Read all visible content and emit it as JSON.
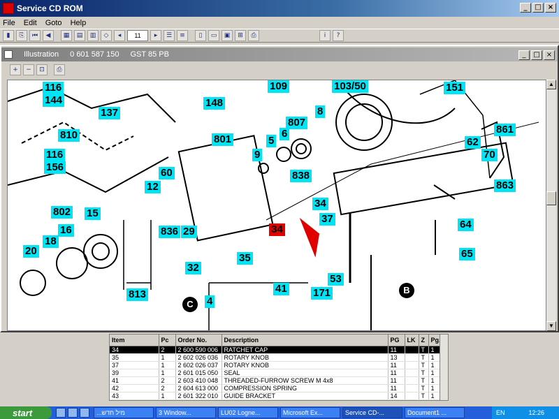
{
  "window": {
    "title": "Service CD ROM",
    "buttons": [
      "_",
      "□",
      "×"
    ]
  },
  "menu": {
    "items": [
      "File",
      "Edit",
      "Goto",
      "Help"
    ]
  },
  "toolbar": {
    "page_value": "11",
    "icons": [
      "exit-icon",
      "copy-icon",
      "first-page-icon",
      "prev-icon",
      "overview-icon",
      "grid-icon",
      "parts-icon",
      "blank-icon",
      "prev-page-icon",
      "next-page-icon",
      "list-icon",
      "list2-icon",
      "new-doc-icon",
      "open-icon",
      "save-icon",
      "bookmark-icon",
      "print-icon",
      "info-icon",
      "help-icon"
    ]
  },
  "illustration": {
    "title": "Illustration",
    "part_no": "0 601 587 150",
    "model": "GST 85 PB",
    "tools": [
      "zoom-in-icon",
      "zoom-out-icon",
      "fit-icon",
      "print-icon"
    ]
  },
  "callouts": [
    {
      "label": "109"
    },
    {
      "label": "103/50"
    },
    {
      "label": "151"
    },
    {
      "label": "116"
    },
    {
      "label": "144"
    },
    {
      "label": "148"
    },
    {
      "label": "137"
    },
    {
      "label": "8"
    },
    {
      "label": "807"
    },
    {
      "label": "6"
    },
    {
      "label": "5"
    },
    {
      "label": "801"
    },
    {
      "label": "810"
    },
    {
      "label": "861"
    },
    {
      "label": "62"
    },
    {
      "label": "116"
    },
    {
      "label": "9"
    },
    {
      "label": "70"
    },
    {
      "label": "156"
    },
    {
      "label": "838"
    },
    {
      "label": "60"
    },
    {
      "label": "863"
    },
    {
      "label": "12"
    },
    {
      "label": "34"
    },
    {
      "label": "802"
    },
    {
      "label": "15"
    },
    {
      "label": "37"
    },
    {
      "label": "16"
    },
    {
      "label": "836"
    },
    {
      "label": "29"
    },
    {
      "label": "34"
    },
    {
      "label": "64"
    },
    {
      "label": "18"
    },
    {
      "label": "20"
    },
    {
      "label": "35"
    },
    {
      "label": "65"
    },
    {
      "label": "32"
    },
    {
      "label": "53"
    },
    {
      "label": "41"
    },
    {
      "label": "171"
    },
    {
      "label": "813"
    },
    {
      "label": "4"
    }
  ],
  "circles": [
    {
      "label": "B"
    },
    {
      "label": "C"
    }
  ],
  "table": {
    "headers": [
      "Item",
      "Pc",
      "Order No.",
      "Description",
      "PG",
      "LK",
      "Z",
      "Pg."
    ],
    "rows": [
      [
        "34",
        "2",
        "2 600 590 006",
        "RATCHET CAP",
        "11",
        "",
        "T",
        "1"
      ],
      [
        "35",
        "1",
        "2 602 026 036",
        "ROTARY KNOB",
        "13",
        "",
        "T",
        "1"
      ],
      [
        "37",
        "1",
        "2 602 026 037",
        "ROTARY KNOB",
        "11",
        "",
        "T",
        "1"
      ],
      [
        "39",
        "1",
        "2 601 015 050",
        "SEAL",
        "11",
        "",
        "T",
        "1"
      ],
      [
        "41",
        "2",
        "2 603 410 048",
        "THREADED-FURROW SCREW M 4x8",
        "11",
        "",
        "T",
        "1"
      ],
      [
        "42",
        "2",
        "2 604 613 000",
        "COMPRESSION SPRING",
        "11",
        "",
        "T",
        "1"
      ],
      [
        "43",
        "1",
        "2 601 322 010",
        "GUIDE BRACKET",
        "14",
        "",
        "T",
        "1"
      ]
    ]
  },
  "taskbar": {
    "start": "start",
    "tasks": [
      "...מיל חדש",
      "3 Window...",
      "LU02 Logne...",
      "Microsoft Ex...",
      "Service CD-...",
      "Document1 ..."
    ],
    "lang": "EN",
    "clock": "12:26"
  }
}
